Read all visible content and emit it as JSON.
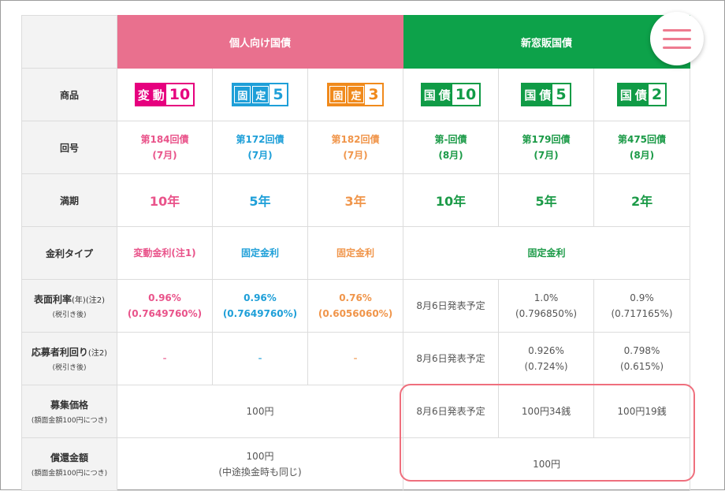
{
  "header": {
    "personal": "個人向け国債",
    "new_window": "新窓販国債"
  },
  "labels": {
    "product": "商品",
    "issue": "回号",
    "maturity": "満期",
    "rate_type": "金利タイプ",
    "coupon_main": "表面利率",
    "coupon_mid": "(年)(注2)",
    "coupon_sub": "(税引き後)",
    "yield_main": "応募者利回り",
    "yield_mid": "(注2)",
    "yield_sub": "(税引き後)",
    "price_main": "募集価格",
    "price_sub": "(額面金額100円につき)",
    "redemption_main": "償還金額",
    "redemption_sub": "(額面金額100円につき)"
  },
  "products": [
    {
      "logo_kanji1": "変",
      "logo_kanji2": "動",
      "logo_num": "10",
      "issue": "第184回債",
      "month": "(7月)",
      "maturity": "10年",
      "rate_type": "変動金利(注1)",
      "coupon": "0.96%",
      "coupon_after": "(0.7649760%)",
      "yield": "-"
    },
    {
      "logo_kanji1": "固",
      "logo_kanji2": "定",
      "logo_num": "5",
      "issue": "第172回債",
      "month": "(7月)",
      "maturity": "5年",
      "rate_type": "固定金利",
      "coupon": "0.96%",
      "coupon_after": "(0.7649760%)",
      "yield": "-"
    },
    {
      "logo_kanji1": "固",
      "logo_kanji2": "定",
      "logo_num": "3",
      "issue": "第182回債",
      "month": "(7月)",
      "maturity": "3年",
      "rate_type": "固定金利",
      "coupon": "0.76%",
      "coupon_after": "(0.6056060%)",
      "yield": "-"
    },
    {
      "logo_kanji1": "国",
      "logo_kanji2": "債",
      "logo_num": "10",
      "issue": "第-回債",
      "month": "(8月)",
      "maturity": "10年",
      "coupon": "8月6日発表予定",
      "yield": "8月6日発表予定",
      "price": "8月6日発表予定"
    },
    {
      "logo_kanji1": "国",
      "logo_kanji2": "債",
      "logo_num": "5",
      "issue": "第179回債",
      "month": "(7月)",
      "maturity": "5年",
      "coupon": "1.0%",
      "coupon_after": "(0.796850%)",
      "yield": "0.926%",
      "yield_after": "(0.724%)",
      "price": "100円34銭"
    },
    {
      "logo_kanji1": "国",
      "logo_kanji2": "債",
      "logo_num": "2",
      "issue": "第475回債",
      "month": "(8月)",
      "maturity": "2年",
      "coupon": "0.9%",
      "coupon_after": "(0.717165%)",
      "yield": "0.798%",
      "yield_after": "(0.615%)",
      "price": "100円19銭"
    }
  ],
  "shared": {
    "new_window_rate_type": "固定金利",
    "personal_price": "100円",
    "personal_redemption": "100円",
    "personal_redemption_note": "(中途換金時も同じ)",
    "new_window_redemption": "100円"
  },
  "colors": {
    "personal_header": "#e9708e",
    "new_window_header": "#0da24a",
    "highlight_border": "#ef6f7d"
  },
  "icons": {
    "menu": "hamburger-menu-icon"
  }
}
